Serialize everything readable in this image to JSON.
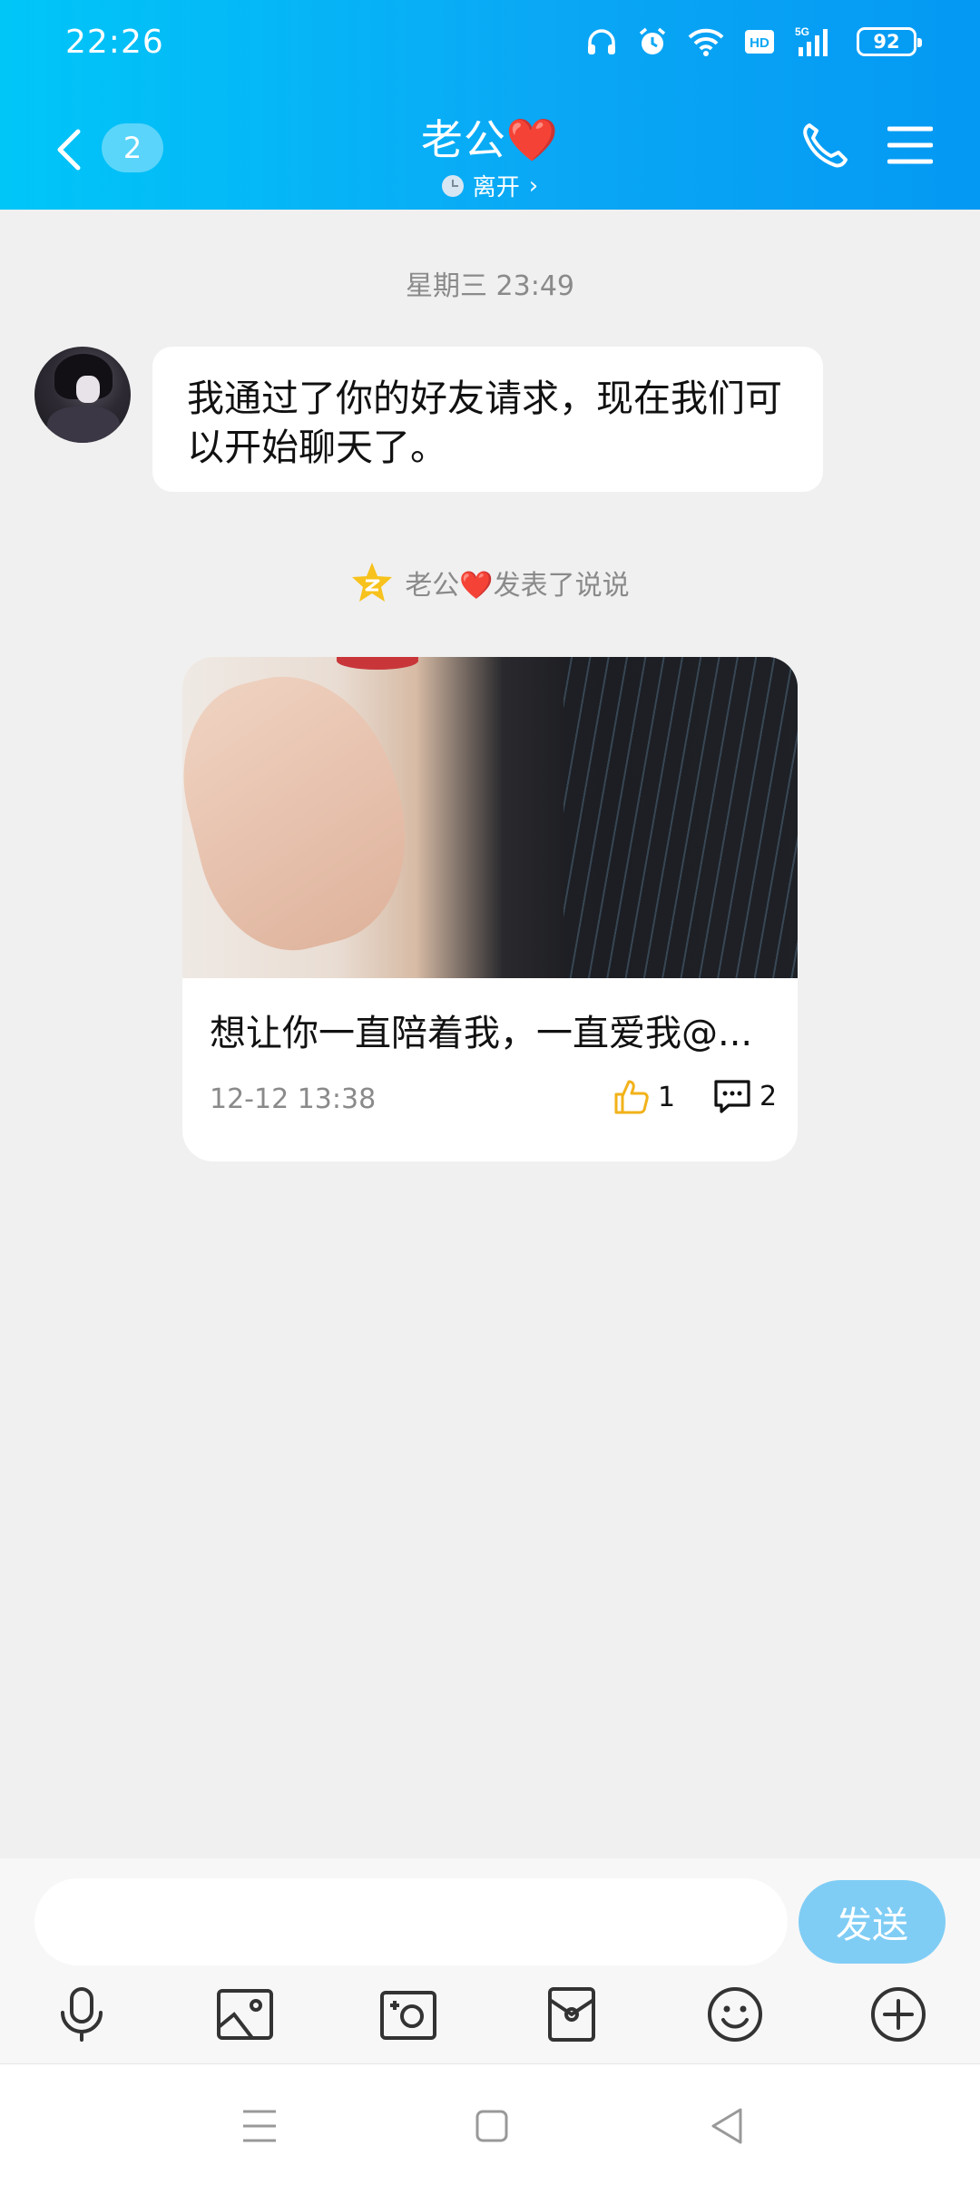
{
  "status_bar": {
    "time": "22:26",
    "battery": "92",
    "icons": [
      "headphones-icon",
      "alarm-icon",
      "wifi-icon",
      "hd-icon",
      "5g-signal-icon",
      "battery-icon"
    ]
  },
  "header": {
    "unread_count": "2",
    "title": "老公❤️",
    "status": "离开",
    "colors": {
      "gradient_start": "#00c6f8",
      "gradient_end": "#0499f3"
    }
  },
  "chat": {
    "timestamp": "星期三 23:49",
    "message": "我通过了你的好友请求，现在我们可以开始聊天了。",
    "notice": "老公❤️发表了说说",
    "post": {
      "text": "想让你一直陪着我，一直爱我@...",
      "date": "12-12 13:38",
      "likes": "1",
      "comments": "2"
    }
  },
  "input": {
    "placeholder": "",
    "send_label": "发送",
    "send_color": "#7fcdf5"
  },
  "toolbar": [
    "microphone-icon",
    "image-icon",
    "camera-icon",
    "red-packet-icon",
    "emoji-icon",
    "plus-icon"
  ],
  "nav": [
    "menu-icon",
    "home-icon",
    "back-icon"
  ]
}
